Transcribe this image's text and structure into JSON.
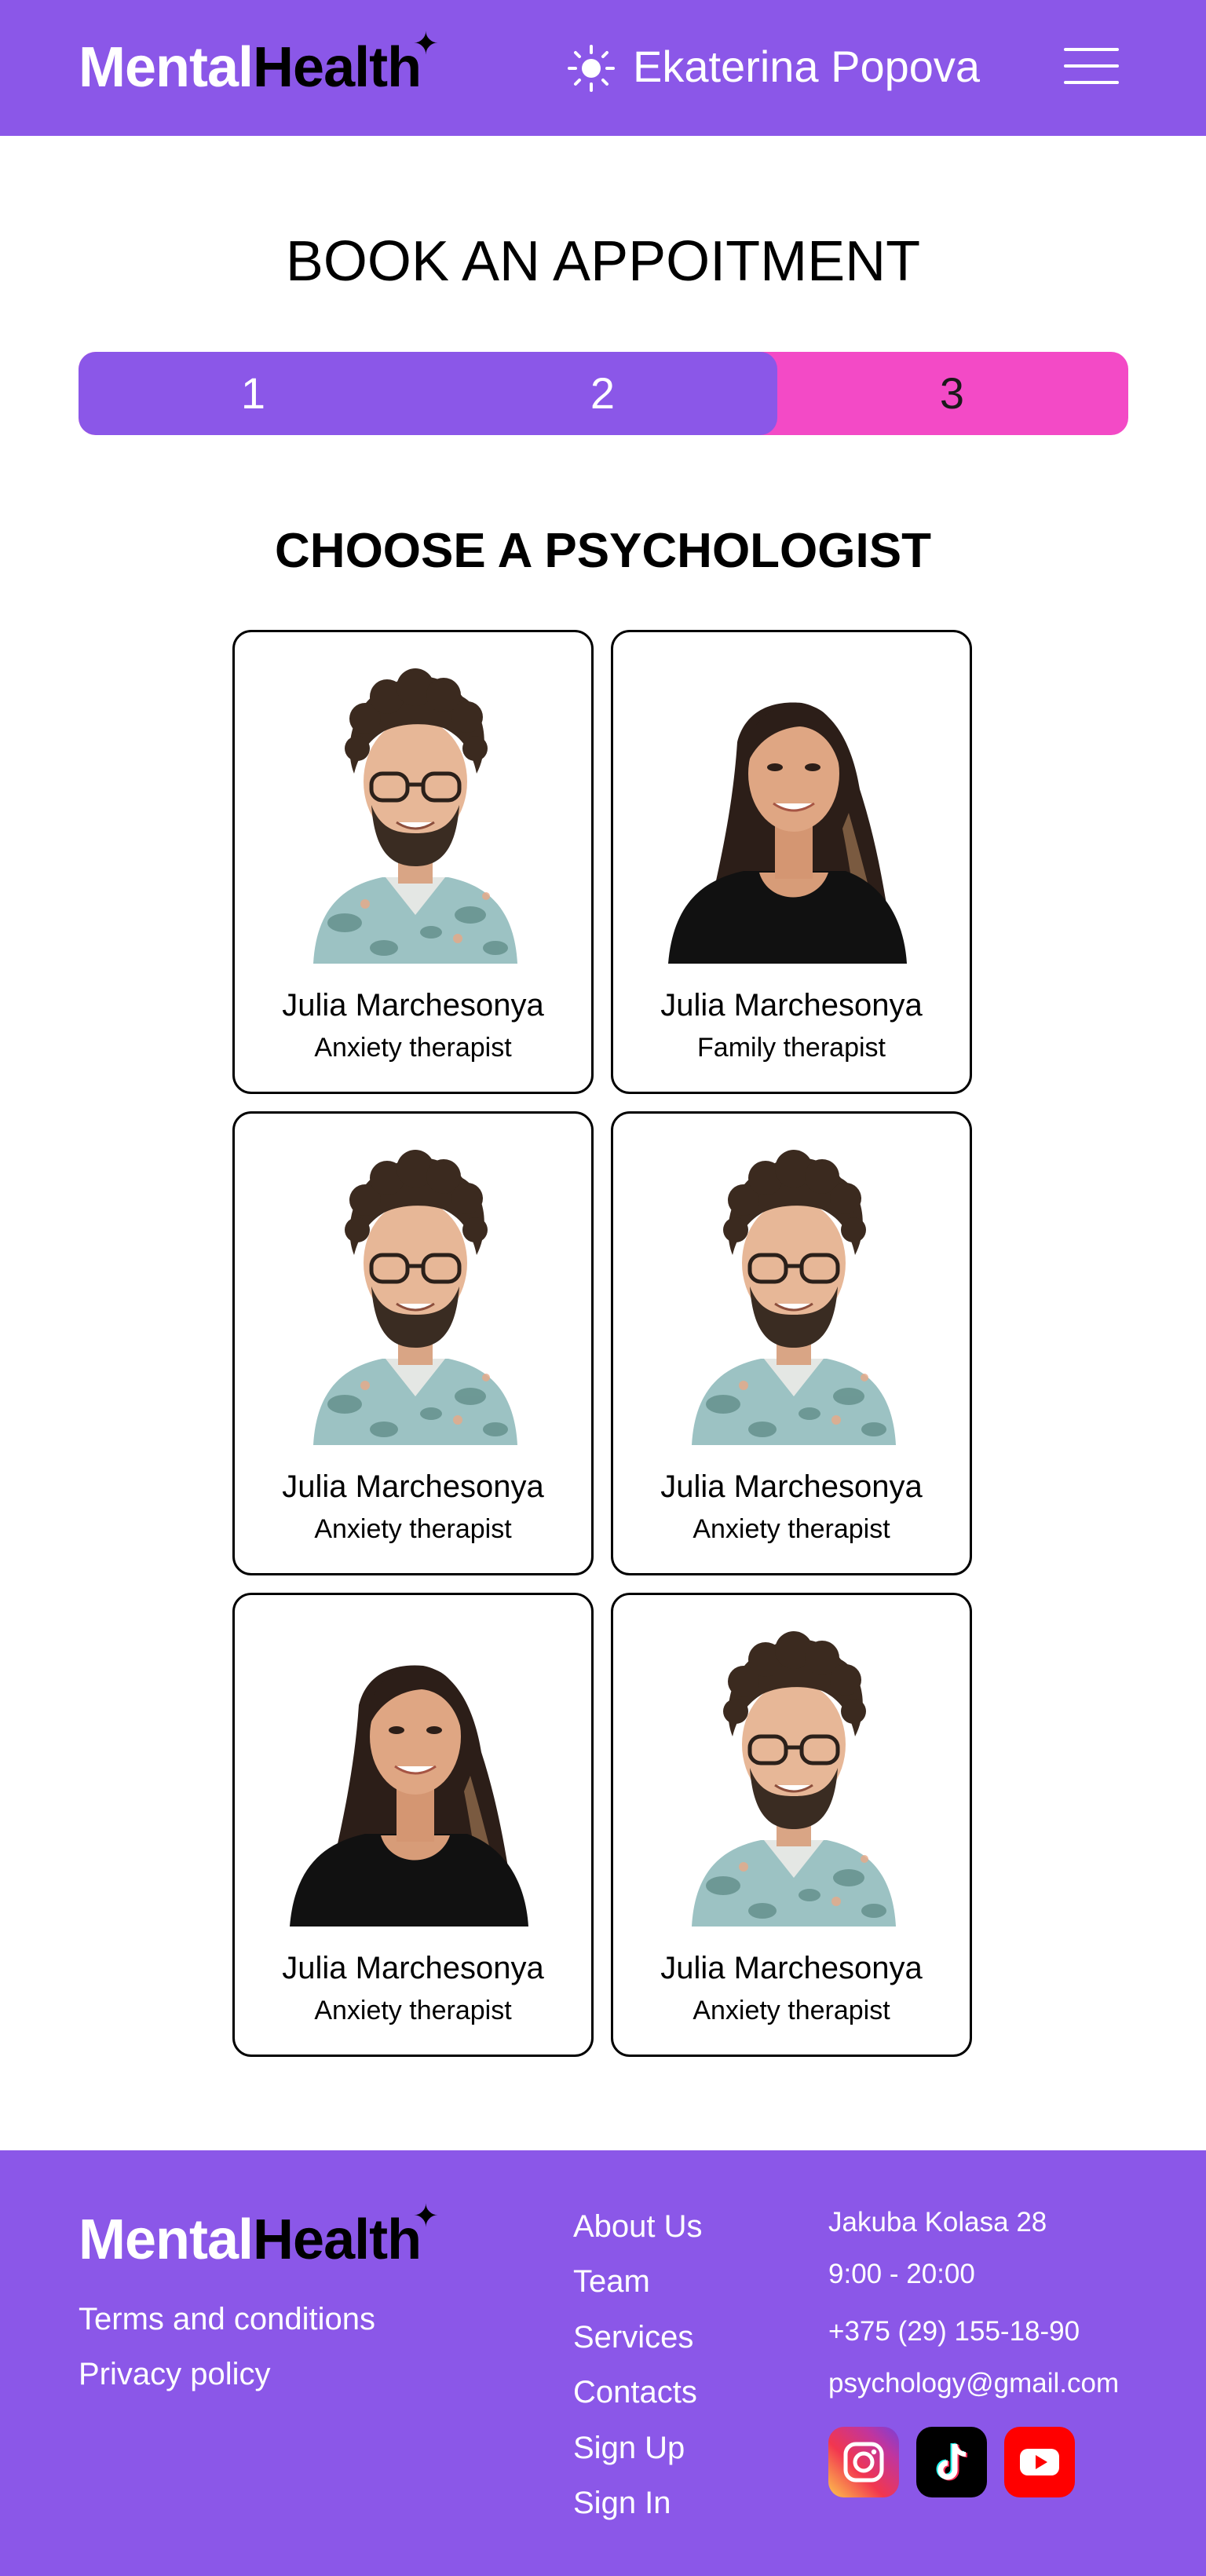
{
  "header": {
    "logo_white": "Mental",
    "logo_black": "Health",
    "theme_icon": "sun-icon",
    "user_name": "Ekaterina Popova",
    "menu_icon": "hamburger-menu-icon"
  },
  "page_title": "BOOK AN APPOITMENT",
  "stepper": {
    "steps": [
      "1",
      "2",
      "3"
    ],
    "current_step": 3
  },
  "section_title": "CHOOSE A PSYCHOLOGIST",
  "psychologists": [
    {
      "name": "Julia Marchesonya",
      "role": "Anxiety therapist",
      "photo": "man-curly-hair-glasses"
    },
    {
      "name": "Julia Marchesonya",
      "role": "Family therapist",
      "photo": "woman-long-dark-hair"
    },
    {
      "name": "Julia Marchesonya",
      "role": "Anxiety therapist",
      "photo": "man-curly-hair-glasses"
    },
    {
      "name": "Julia Marchesonya",
      "role": "Anxiety therapist",
      "photo": "man-curly-hair-glasses"
    },
    {
      "name": "Julia Marchesonya",
      "role": "Anxiety therapist",
      "photo": "woman-long-dark-hair"
    },
    {
      "name": "Julia Marchesonya",
      "role": "Anxiety therapist",
      "photo": "man-curly-hair-glasses"
    }
  ],
  "footer": {
    "logo_white": "Mental",
    "logo_black": "Health",
    "legal": [
      "Terms and conditions",
      "Privacy policy"
    ],
    "nav": [
      "About Us",
      "Team",
      "Services",
      "Contacts",
      "Sign Up",
      "Sign In"
    ],
    "contacts": {
      "address": "Jakuba Kolasa 28",
      "hours": "9:00 - 20:00",
      "phone": "+375 (29) 155-18-90",
      "email": "psychology@gmail.com"
    },
    "social": [
      "instagram-icon",
      "tiktok-icon",
      "youtube-icon"
    ]
  },
  "colors": {
    "brand": "#8B57E8",
    "accent": "#F34AC6"
  }
}
